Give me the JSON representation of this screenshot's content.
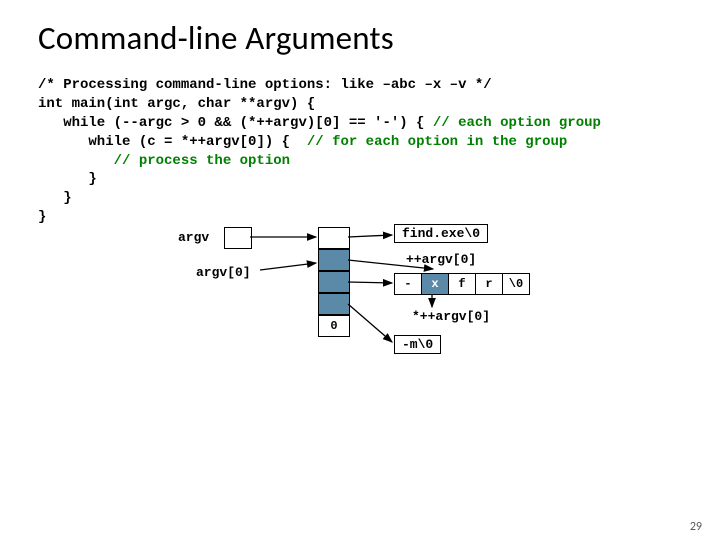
{
  "title": "Command-line Arguments",
  "code": {
    "l1": "/* Processing command-line options: like –abc –x –v */",
    "l2": "int main(int argc, char **argv) {",
    "l3a": "   while (--argc > 0 && (*++argv)[0] == '-') { ",
    "l3b": "// each option group",
    "l4a": "      while (c = ",
    "l4b": "*++argv[0]",
    "l4c": ") {  ",
    "l4d": "// for each option in the group",
    "l5": "         // process the option",
    "l6": "      }",
    "l7": "   }",
    "l8": "}"
  },
  "diagram": {
    "argv_label": "argv",
    "argv0_label": "argv[0]",
    "zero_cell": "0",
    "prog_label": "find.exe\\0",
    "inc_label": "++argv[0]",
    "row_chars": [
      "-",
      "x",
      "f",
      "r",
      "\\0"
    ],
    "deref_label": "*++argv[0]",
    "m_label": "-m\\0"
  },
  "page_number": "29"
}
